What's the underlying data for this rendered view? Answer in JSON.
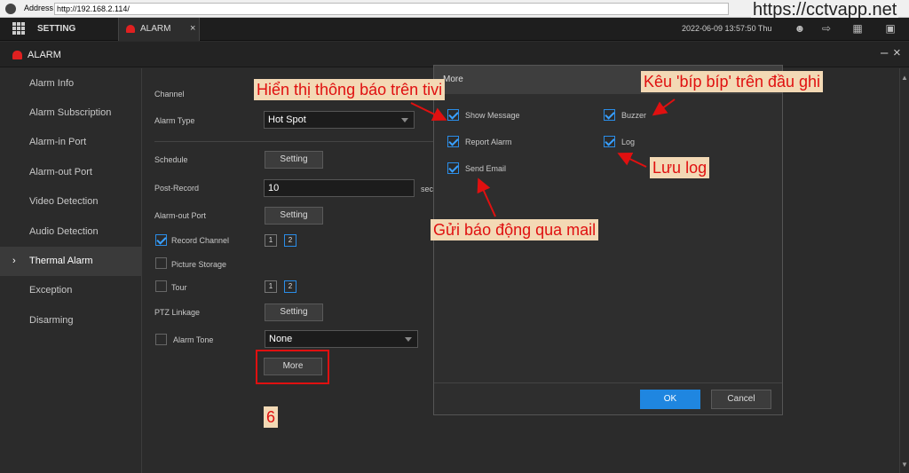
{
  "browser": {
    "address_label": "Address",
    "url": "http://192.168.2.114/"
  },
  "watermark": "https://cctvapp.net",
  "topnav": {
    "setting_label": "SETTING",
    "tab_label": "ALARM",
    "tab_close": "×",
    "datetime": "2022-06-09 13:57:50 Thu"
  },
  "header": {
    "title": "ALARM",
    "minimize": "–",
    "close": "×"
  },
  "sidebar": {
    "items": [
      {
        "label": "Alarm Info"
      },
      {
        "label": "Alarm Subscription"
      },
      {
        "label": "Alarm-in Port"
      },
      {
        "label": "Alarm-out Port"
      },
      {
        "label": "Video Detection"
      },
      {
        "label": "Audio Detection"
      },
      {
        "label": "Thermal Alarm",
        "active": true
      },
      {
        "label": "Exception"
      },
      {
        "label": "Disarming"
      }
    ]
  },
  "form": {
    "channel_label": "Channel",
    "alarm_type_label": "Alarm Type",
    "alarm_type_value": "Hot Spot",
    "schedule_label": "Schedule",
    "schedule_btn": "Setting",
    "post_record_label": "Post-Record",
    "post_record_value": "10",
    "post_record_unit": "sec",
    "alarm_out_label": "Alarm-out Port",
    "alarm_out_btn": "Setting",
    "record_channel_label": "Record Channel",
    "picture_storage_label": "Picture Storage",
    "tour_label": "Tour",
    "ptz_label": "PTZ Linkage",
    "ptz_btn": "Setting",
    "alarm_tone_label": "Alarm Tone",
    "alarm_tone_value": "None",
    "more_btn": "More",
    "channels": [
      "1",
      "2"
    ]
  },
  "dialog": {
    "title": "More",
    "show_message": "Show Message",
    "buzzer": "Buzzer",
    "report_alarm": "Report Alarm",
    "log": "Log",
    "send_email": "Send Email",
    "ok": "OK",
    "cancel": "Cancel"
  },
  "annotations": {
    "show_message": "Hiển thị thông báo trên tivi",
    "buzzer": "Kêu 'bíp bíp' trên đầu ghi",
    "log": "Lưu log",
    "email": "Gửi báo động qua mail",
    "step": "6"
  },
  "colors": {
    "accent": "#1f86e0",
    "annotation": "#e01010",
    "annotation_bg": "#f3d9b5"
  }
}
